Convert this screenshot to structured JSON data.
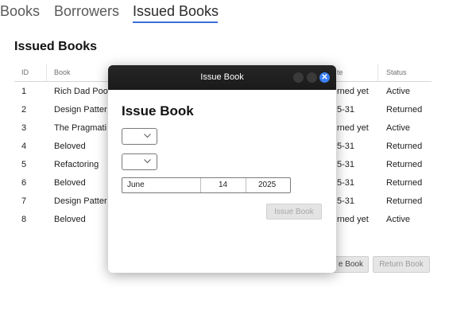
{
  "tabs": [
    {
      "label": "Books"
    },
    {
      "label": "Borrowers"
    },
    {
      "label": "Issued Books"
    }
  ],
  "page_title": "Issued Books",
  "table": {
    "headers": [
      "ID",
      "Book",
      "",
      "Status"
    ],
    "header_date_fragment": "te",
    "rows": [
      {
        "id": "1",
        "book": "Rich Dad Poo",
        "date": "rned yet",
        "status": "Active"
      },
      {
        "id": "2",
        "book": "Design Patter",
        "date": "5-31",
        "status": "Returned"
      },
      {
        "id": "3",
        "book": "The Pragmati",
        "date": "rned yet",
        "status": "Active"
      },
      {
        "id": "4",
        "book": "Beloved",
        "date": "5-31",
        "status": "Returned"
      },
      {
        "id": "5",
        "book": "Refactoring",
        "date": "5-31",
        "status": "Returned"
      },
      {
        "id": "6",
        "book": "Beloved",
        "date": "5-31",
        "status": "Returned"
      },
      {
        "id": "7",
        "book": "Design Patter",
        "date": "5-31",
        "status": "Returned"
      },
      {
        "id": "8",
        "book": "Beloved",
        "date": "rned yet",
        "status": "Active"
      }
    ]
  },
  "bottom_buttons": {
    "issue_fragment": "e Book",
    "return": "Return Book"
  },
  "modal": {
    "window_title": "Issue Book",
    "heading": "Issue Book",
    "date": {
      "month": "June",
      "day": "14",
      "year": "2025"
    },
    "issue_button": "Issue Book",
    "close_glyph": "✕"
  },
  "colors": {
    "accent": "#3b6fd8",
    "titlebar": "#1f1f1f",
    "close_button": "#3b7ff5"
  }
}
